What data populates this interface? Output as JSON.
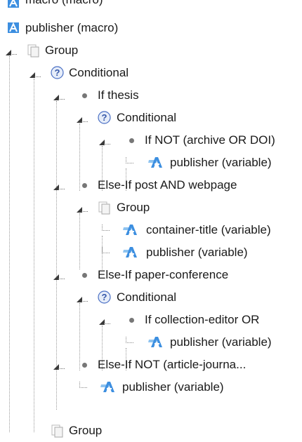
{
  "colors": {
    "guide": "#9a9a9a",
    "icon_blue": "#3d8fe0",
    "help_blue": "#4a6fc4",
    "bullet": "#777777"
  },
  "tree": {
    "partial_top_label": "macro (macro)",
    "rows": [
      {
        "label": "publisher (macro)",
        "icon": "macro-icon"
      },
      {
        "label": "Group",
        "icon": "group-icon"
      },
      {
        "label": "Conditional",
        "icon": "conditional-icon"
      },
      {
        "label": "If thesis",
        "icon": "bullet-icon"
      },
      {
        "label": "Conditional",
        "icon": "conditional-icon"
      },
      {
        "label": "If NOT (archive OR DOI)",
        "icon": "bullet-icon"
      },
      {
        "label": "publisher (variable)",
        "icon": "variable-icon"
      },
      {
        "label": "Else-If post AND webpage",
        "icon": "bullet-icon"
      },
      {
        "label": "Group",
        "icon": "group-icon"
      },
      {
        "label": "container-title (variable)",
        "icon": "variable-icon"
      },
      {
        "label": "publisher (variable)",
        "icon": "variable-icon"
      },
      {
        "label": "Else-If paper-conference",
        "icon": "bullet-icon"
      },
      {
        "label": "Conditional",
        "icon": "conditional-icon"
      },
      {
        "label": "If collection-editor OR",
        "icon": "bullet-icon"
      },
      {
        "label": "publisher (variable)",
        "icon": "variable-icon"
      },
      {
        "label": "Else-If NOT (article-journa...",
        "icon": "bullet-icon"
      },
      {
        "label": "publisher (variable)",
        "icon": "variable-icon"
      },
      {
        "label": "Group",
        "icon": "group-icon"
      }
    ]
  }
}
